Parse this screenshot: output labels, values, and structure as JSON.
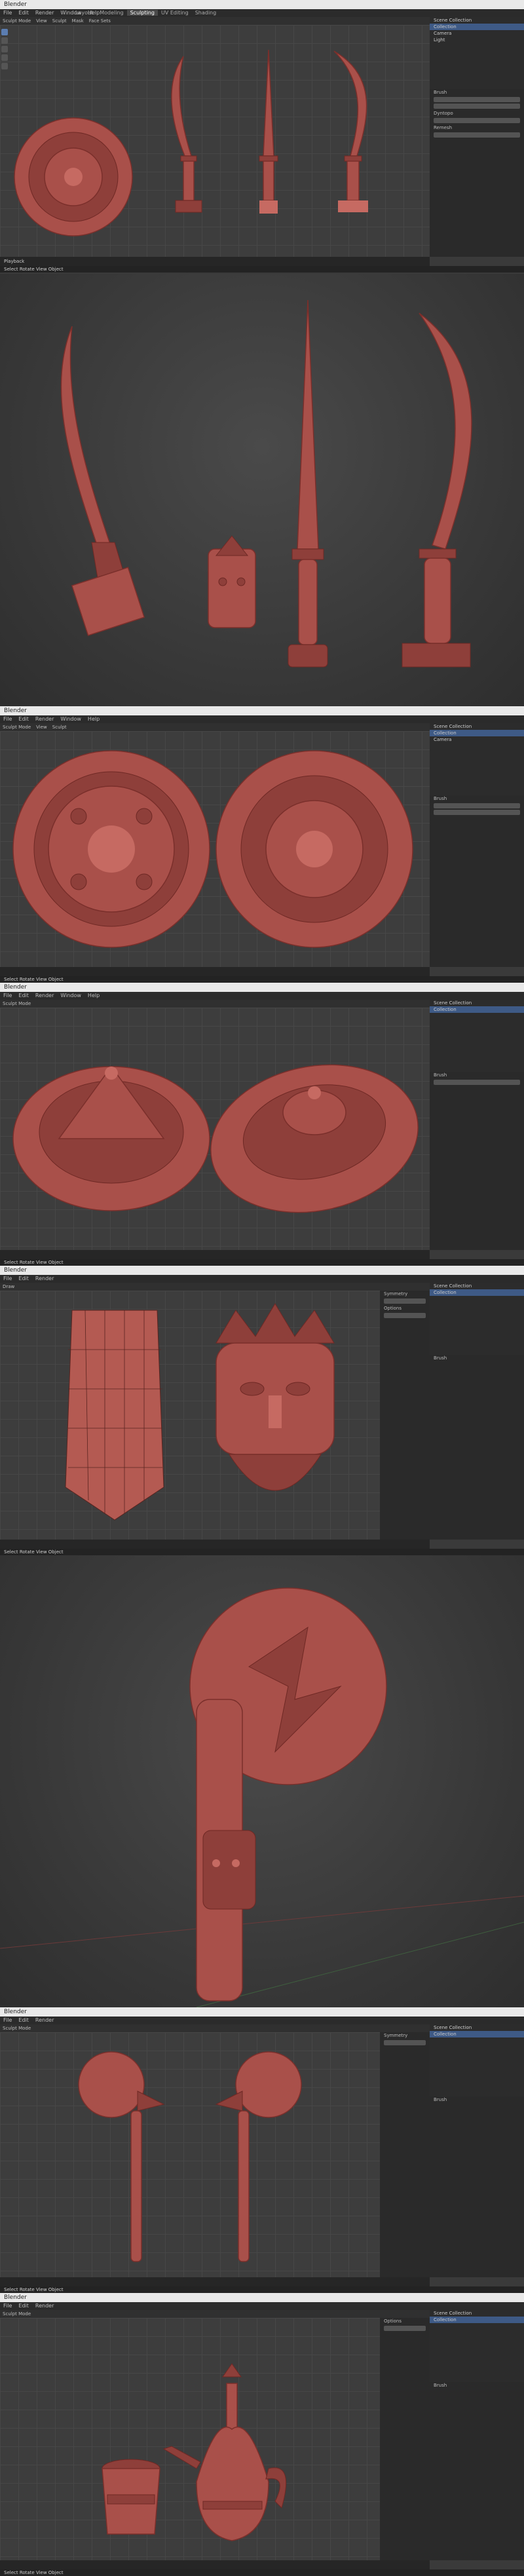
{
  "app": {
    "window_title": "Blender",
    "menus": [
      "File",
      "Edit",
      "Render",
      "Window",
      "Help"
    ],
    "workspaces": [
      "Layout",
      "Modeling",
      "Sculpting",
      "UV Editing",
      "Texture Paint",
      "Shading",
      "Animation",
      "Rendering",
      "Compositing",
      "Scripting"
    ],
    "active_workspace": "Sculpting"
  },
  "viewport_header": {
    "mode": "Sculpt Mode",
    "items": [
      "View",
      "Sculpt",
      "Mask",
      "Face Sets"
    ],
    "brush_label": "Draw"
  },
  "outliner": {
    "header": "Scene Collection",
    "rows": [
      "Collection",
      "Camera",
      "Light"
    ]
  },
  "properties": {
    "sections": [
      "Brush",
      "Dyntopo",
      "Remesh",
      "Symmetry",
      "Options"
    ]
  },
  "timeline": {
    "items": [
      "Playback",
      "Keying",
      "View",
      "Marker"
    ]
  },
  "statusbar": {
    "text": "Select   Rotate View   Object"
  },
  "colors": {
    "clay": "#a9504a",
    "viewport_bg": "#3d3d3d",
    "selection": "#3e5a86"
  },
  "scenes": [
    {
      "name": "panel-1",
      "content": "shield and three daggers"
    },
    {
      "name": "panel-2",
      "content": "dagger close-up render"
    },
    {
      "name": "panel-3",
      "content": "two round shields top view"
    },
    {
      "name": "panel-4",
      "content": "two shields perspective view"
    },
    {
      "name": "panel-5",
      "content": "mask front and wireframe"
    },
    {
      "name": "panel-6",
      "content": "mace close-up render"
    },
    {
      "name": "panel-7",
      "content": "two maces"
    },
    {
      "name": "panel-8",
      "content": "cup and jug"
    }
  ]
}
